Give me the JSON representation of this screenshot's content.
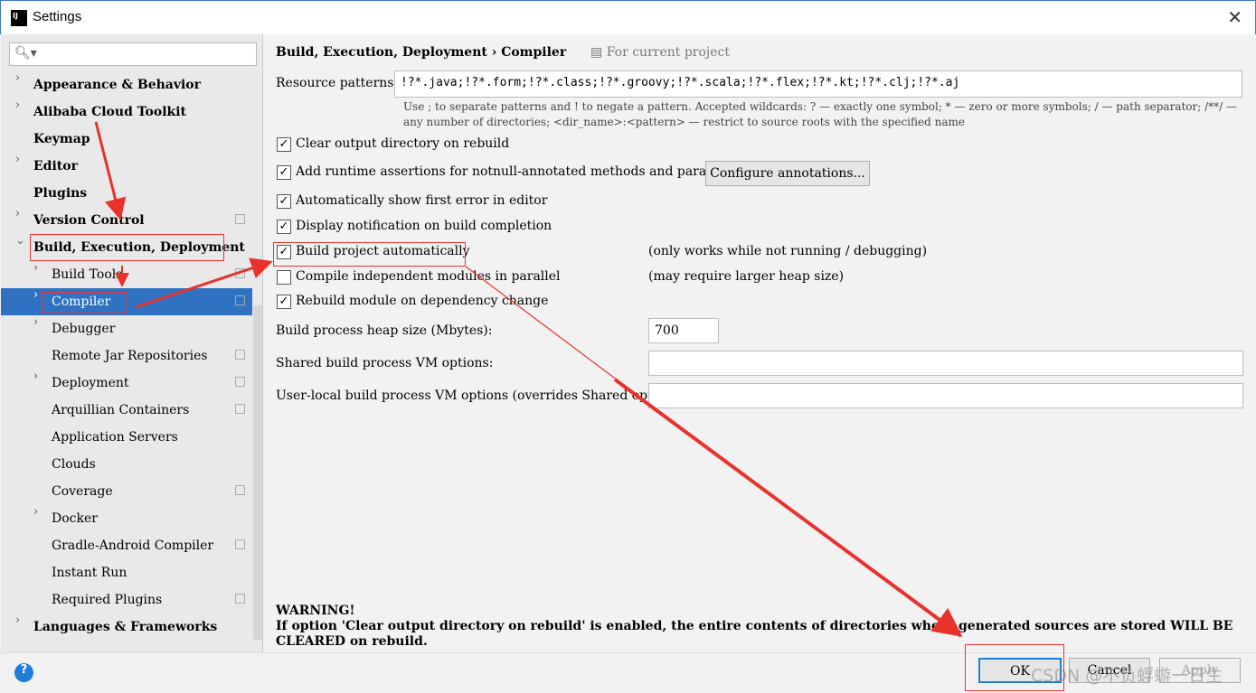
{
  "window": {
    "title": "Settings",
    "close": "✕",
    "logo": "IJ"
  },
  "sidebar": {
    "search_icon": "🔍︎▾",
    "items": [
      {
        "label": "Appearance & Behavior",
        "expand": "›",
        "bold": true
      },
      {
        "label": "Alibaba Cloud Toolkit",
        "expand": "›",
        "bold": true
      },
      {
        "label": "Keymap",
        "bold": true
      },
      {
        "label": "Editor",
        "expand": "›",
        "bold": true
      },
      {
        "label": "Plugins",
        "bold": true
      },
      {
        "label": "Version Control",
        "expand": "›",
        "bold": true,
        "copy": true
      },
      {
        "label": "Build, Execution, Deployment",
        "expand": "⌄",
        "bold": true
      },
      {
        "label": "Build Tools",
        "expand": "›",
        "copy": true
      },
      {
        "label": "Compiler",
        "expand": "›",
        "copy": true,
        "selected": true
      },
      {
        "label": "Debugger",
        "expand": "›"
      },
      {
        "label": "Remote Jar Repositories",
        "copy": true
      },
      {
        "label": "Deployment",
        "expand": "›",
        "copy": true
      },
      {
        "label": "Arquillian Containers",
        "copy": true
      },
      {
        "label": "Application Servers"
      },
      {
        "label": "Clouds"
      },
      {
        "label": "Coverage",
        "copy": true
      },
      {
        "label": "Docker",
        "expand": "›"
      },
      {
        "label": "Gradle-Android Compiler",
        "copy": true
      },
      {
        "label": "Instant Run"
      },
      {
        "label": "Required Plugins",
        "copy": true
      },
      {
        "label": "Languages & Frameworks",
        "expand": "›",
        "bold": true
      }
    ]
  },
  "main": {
    "breadcrumb": "Build, Execution, Deployment  ›  Compiler",
    "project_scope": "For current project",
    "resource_label": "Resource patterns:",
    "resource_value": "!?*.java;!?*.form;!?*.class;!?*.groovy;!?*.scala;!?*.flex;!?*.kt;!?*.clj;!?*.aj",
    "hint1": "Use ; to separate patterns and ! to negate a pattern. Accepted wildcards: ? — exactly one symbol; * — zero or more symbols; / — path separator; /**/ —",
    "hint2": "any number of directories; <dir_name>:<pattern> — restrict to source roots with the specified name",
    "options": [
      {
        "label": "Clear output directory on rebuild",
        "checked": true
      },
      {
        "label": "Add runtime assertions for notnull-annotated methods and parameters",
        "checked": true
      },
      {
        "label": "Automatically show first error in editor",
        "checked": true
      },
      {
        "label": "Display notification on build completion",
        "checked": true
      },
      {
        "label": "Build project automatically",
        "checked": true,
        "note": "(only works while not running / debugging)"
      },
      {
        "label": "Compile independent modules in parallel",
        "checked": false,
        "note": "(may require larger heap size)"
      },
      {
        "label": "Rebuild module on dependency change",
        "checked": true
      }
    ],
    "configure_button": "Configure annotations...",
    "heap_label": "Build process heap size (Mbytes):",
    "heap_value": "700",
    "shared_vm_label": "Shared build process VM options:",
    "shared_vm_value": "",
    "user_vm_label": "User-local build process VM options (overrides Shared options):",
    "user_vm_value": "",
    "warning_title": "WARNING!",
    "warning_text": "If option 'Clear output directory on rebuild' is enabled, the entire contents of directories where generated sources are stored WILL BE CLEARED on rebuild."
  },
  "footer": {
    "help": "?",
    "ok": "OK",
    "cancel": "Cancel",
    "apply": "Apply"
  },
  "watermark": "CSDN @不负蜉蝣一日生",
  "annotation_color": "#e8322b"
}
